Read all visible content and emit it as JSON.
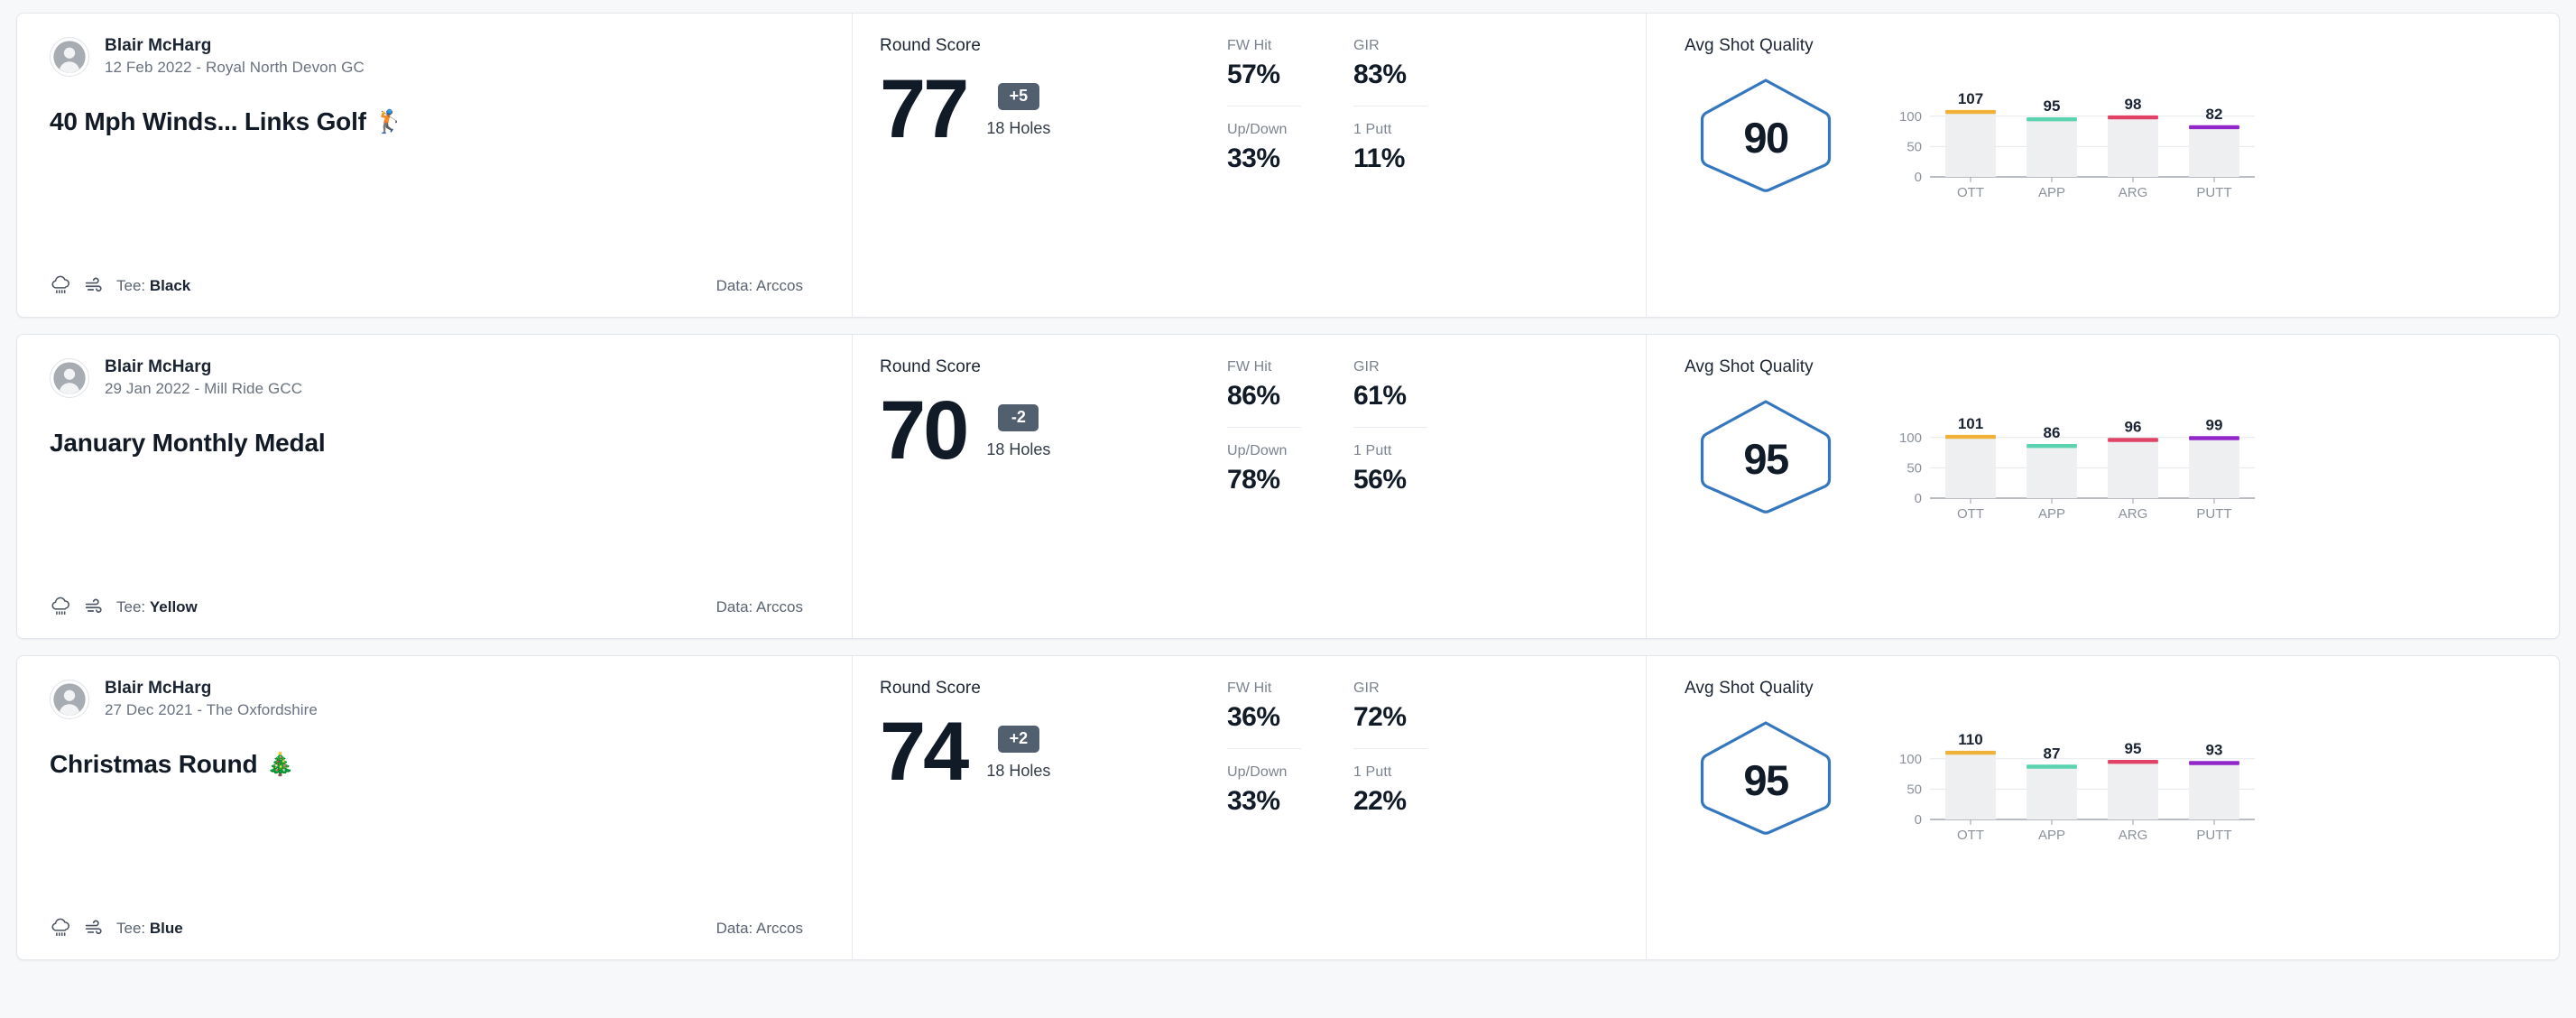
{
  "rounds": [
    {
      "player": "Blair McHarg",
      "meta": "12 Feb 2022 - Royal North Devon GC",
      "title": "40 Mph Winds... Links Golf",
      "title_emoji": "🏌️",
      "tee_prefix": "Tee: ",
      "tee": "Black",
      "data_source": "Data: Arccos",
      "score_label": "Round Score",
      "score": "77",
      "to_par": "+5",
      "holes": "18 Holes",
      "stats": [
        {
          "key": "FW Hit",
          "value": "57%"
        },
        {
          "key": "GIR",
          "value": "83%"
        },
        {
          "key": "Up/Down",
          "value": "33%"
        },
        {
          "key": "1 Putt",
          "value": "11%"
        }
      ],
      "quality_label": "Avg Shot Quality",
      "quality_score": "90",
      "chart_data": {
        "type": "bar",
        "title": "Avg Shot Quality",
        "categories": [
          "OTT",
          "APP",
          "ARG",
          "PUTT"
        ],
        "values": [
          107,
          95,
          98,
          82
        ],
        "colors": [
          "#f0b13b",
          "#5bd3b0",
          "#e04365",
          "#9126c9"
        ],
        "yticks": [
          0,
          50,
          100
        ],
        "ylim": [
          0,
          125
        ],
        "xlabel": "",
        "ylabel": "",
        "grid": true,
        "legend": "none"
      }
    },
    {
      "player": "Blair McHarg",
      "meta": "29 Jan 2022 - Mill Ride GCC",
      "title": "January Monthly Medal",
      "title_emoji": "",
      "tee_prefix": "Tee: ",
      "tee": "Yellow",
      "data_source": "Data: Arccos",
      "score_label": "Round Score",
      "score": "70",
      "to_par": "-2",
      "holes": "18 Holes",
      "stats": [
        {
          "key": "FW Hit",
          "value": "86%"
        },
        {
          "key": "GIR",
          "value": "61%"
        },
        {
          "key": "Up/Down",
          "value": "78%"
        },
        {
          "key": "1 Putt",
          "value": "56%"
        }
      ],
      "quality_label": "Avg Shot Quality",
      "quality_score": "95",
      "chart_data": {
        "type": "bar",
        "title": "Avg Shot Quality",
        "categories": [
          "OTT",
          "APP",
          "ARG",
          "PUTT"
        ],
        "values": [
          101,
          86,
          96,
          99
        ],
        "colors": [
          "#f0b13b",
          "#5bd3b0",
          "#e04365",
          "#9126c9"
        ],
        "yticks": [
          0,
          50,
          100
        ],
        "ylim": [
          0,
          125
        ],
        "xlabel": "",
        "ylabel": "",
        "grid": true,
        "legend": "none"
      }
    },
    {
      "player": "Blair McHarg",
      "meta": "27 Dec 2021 - The Oxfordshire",
      "title": "Christmas Round",
      "title_emoji": "🎄",
      "tee_prefix": "Tee: ",
      "tee": "Blue",
      "data_source": "Data: Arccos",
      "score_label": "Round Score",
      "score": "74",
      "to_par": "+2",
      "holes": "18 Holes",
      "stats": [
        {
          "key": "FW Hit",
          "value": "36%"
        },
        {
          "key": "GIR",
          "value": "72%"
        },
        {
          "key": "Up/Down",
          "value": "33%"
        },
        {
          "key": "1 Putt",
          "value": "22%"
        }
      ],
      "quality_label": "Avg Shot Quality",
      "quality_score": "95",
      "chart_data": {
        "type": "bar",
        "title": "Avg Shot Quality",
        "categories": [
          "OTT",
          "APP",
          "ARG",
          "PUTT"
        ],
        "values": [
          110,
          87,
          95,
          93
        ],
        "colors": [
          "#f0b13b",
          "#5bd3b0",
          "#e04365",
          "#9126c9"
        ],
        "yticks": [
          0,
          50,
          100
        ],
        "ylim": [
          0,
          125
        ],
        "xlabel": "",
        "ylabel": "",
        "grid": true,
        "legend": "none"
      }
    }
  ],
  "theme": {
    "hexagon_stroke": "#3577bf",
    "chip_bg": "#525f6e",
    "bar_fill": "#eeeff0",
    "text_dark": "#111a27",
    "text_muted": "#8b929b",
    "card_bg": "#ffffff",
    "page_bg": "#f7f8fa"
  },
  "icons": {
    "avatar": "person-icon",
    "weather": "rain-cloud-icon",
    "wind": "wind-icon"
  }
}
